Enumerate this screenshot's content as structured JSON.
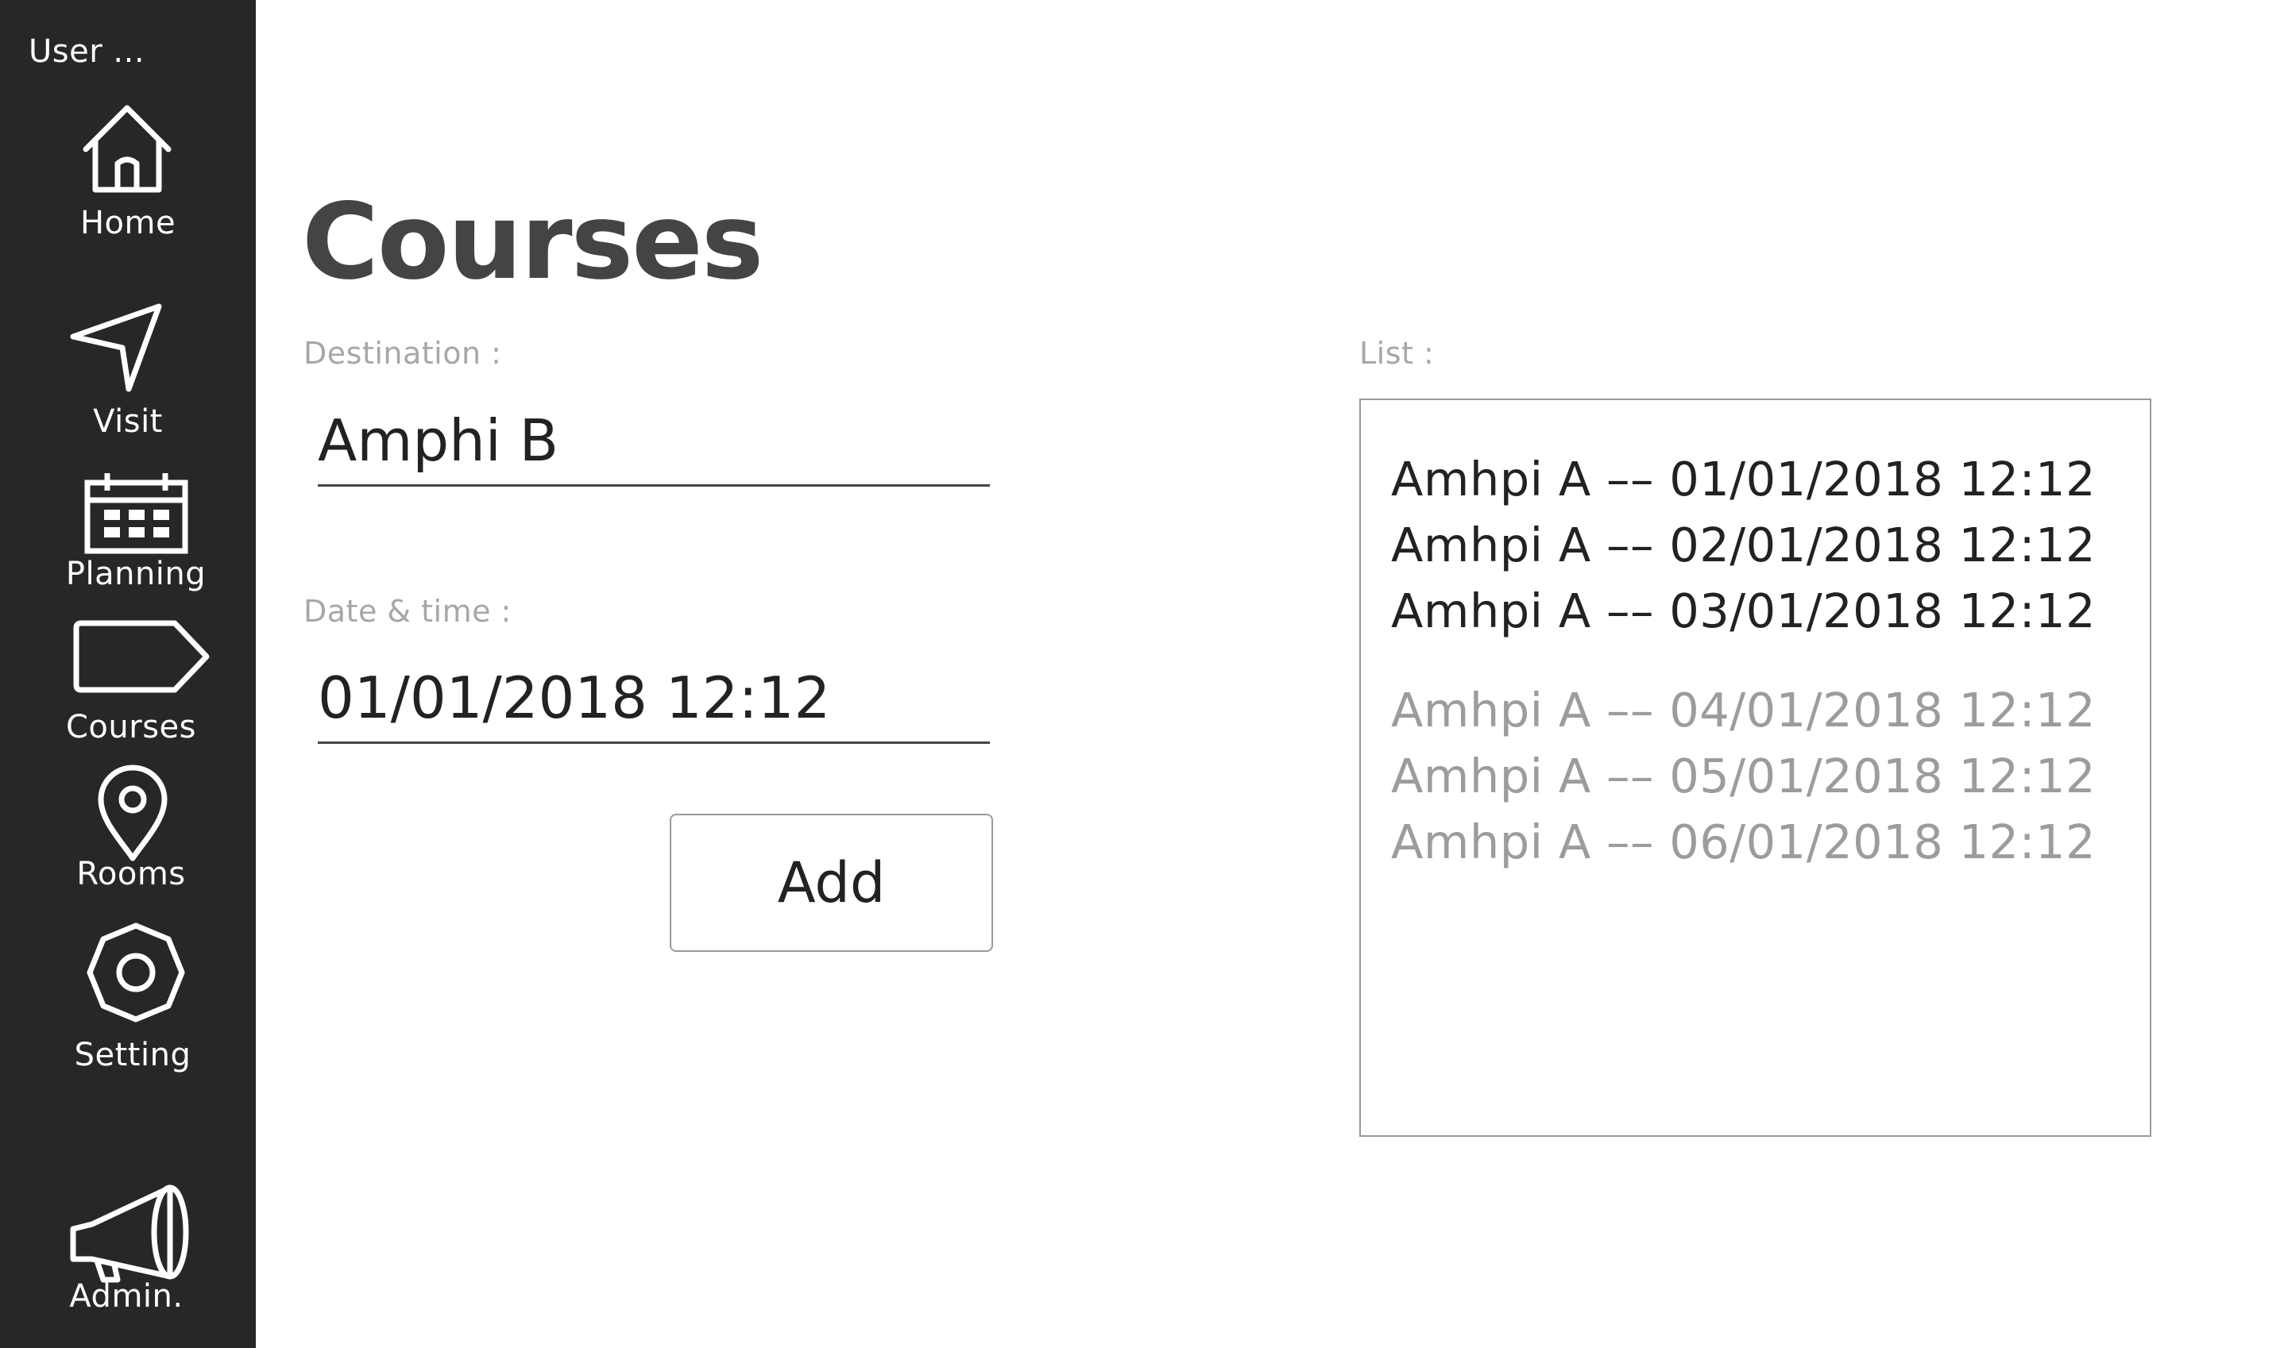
{
  "sidebar": {
    "user_label": "User ...",
    "items": [
      {
        "label": "Home",
        "icon": "home-icon"
      },
      {
        "label": "Visit",
        "icon": "navigation-arrow-icon"
      },
      {
        "label": "Planning",
        "icon": "calendar-icon"
      },
      {
        "label": "Courses",
        "icon": "tag-icon"
      },
      {
        "label": "Rooms",
        "icon": "location-pin-icon"
      },
      {
        "label": "Setting",
        "icon": "gear-icon"
      },
      {
        "label": "Admin.",
        "icon": "megaphone-icon"
      }
    ]
  },
  "main": {
    "title": "Courses",
    "destination": {
      "label": "Destination :",
      "value": "Amphi B"
    },
    "datetime": {
      "label": "Date & time :",
      "value": "01/01/2018 12:12"
    },
    "add_button": "Add",
    "list": {
      "label": "List :",
      "items": [
        {
          "text": "Amhpi A –– 01/01/2018 12:12",
          "status": "past"
        },
        {
          "text": "Amhpi A –– 02/01/2018 12:12",
          "status": "past"
        },
        {
          "text": "Amhpi A –– 03/01/2018 12:12",
          "status": "past"
        },
        {
          "text": "Amhpi A –– 04/01/2018 12:12",
          "status": "upcoming"
        },
        {
          "text": "Amhpi A –– 05/01/2018 12:12",
          "status": "upcoming"
        },
        {
          "text": "Amhpi A –– 06/01/2018 12:12",
          "status": "upcoming"
        }
      ]
    }
  },
  "colors": {
    "sidebar_bg": "#272727",
    "title_text": "#444444",
    "label_text": "#a7a7a7",
    "muted_item_text": "#9c9c9c",
    "border": "#9a9a9a"
  }
}
